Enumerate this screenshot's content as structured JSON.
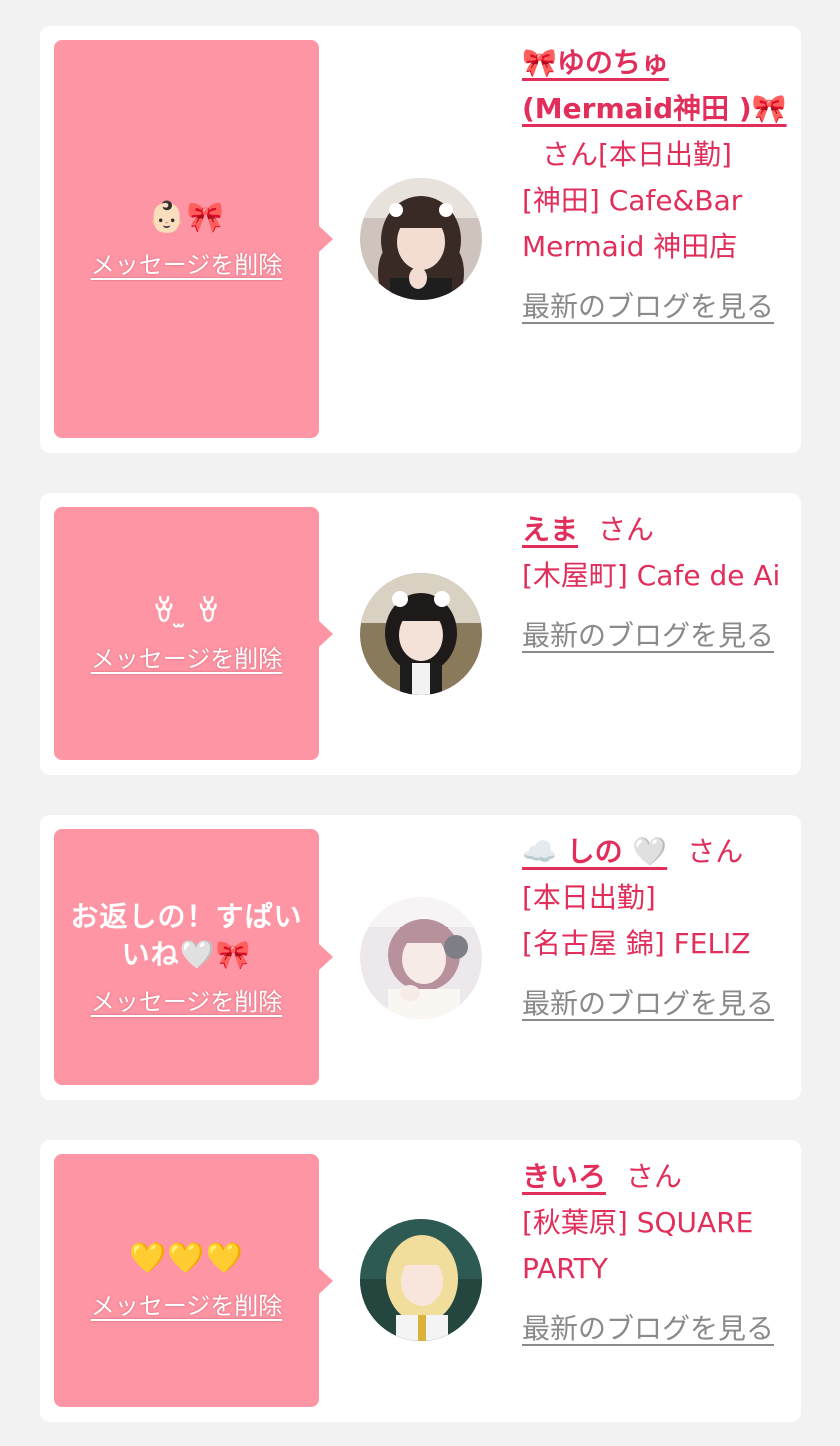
{
  "cards": [
    {
      "message": "👶🏻🎀",
      "delete_label": "メッセージを削除",
      "name": "🎀ゆのちゅ(Mermaid神田 )🎀",
      "honorific": "さん",
      "status": "[本日出勤]",
      "shop": "[神田] Cafe&Bar Mermaid 神田店",
      "blog_label": "最新のブログを見る"
    },
    {
      "message": "ꈊ ̫ ꈊ",
      "delete_label": "メッセージを削除",
      "name": "えま",
      "honorific": "さん",
      "status": "",
      "shop": "[木屋町] Cafe de Ai",
      "blog_label": "最新のブログを見る"
    },
    {
      "message": "お返しの！すぱいいね🤍🎀",
      "delete_label": "メッセージを削除",
      "name": "☁️ しの 🤍",
      "honorific": "さん",
      "status": "[本日出勤]",
      "shop": "[名古屋 錦] FELIZ",
      "blog_label": "最新のブログを見る"
    },
    {
      "message": "💛💛💛",
      "delete_label": "メッセージを削除",
      "name": "きいろ",
      "honorific": "さん",
      "status": "",
      "shop": "[秋葉原] SQUARE PARTY",
      "blog_label": "最新のブログを見る"
    }
  ],
  "colors": {
    "background": "#f2f2f2",
    "bubble": "#fe95a4",
    "accent": "#e12e5b",
    "link_gray": "#8a8a8a"
  }
}
